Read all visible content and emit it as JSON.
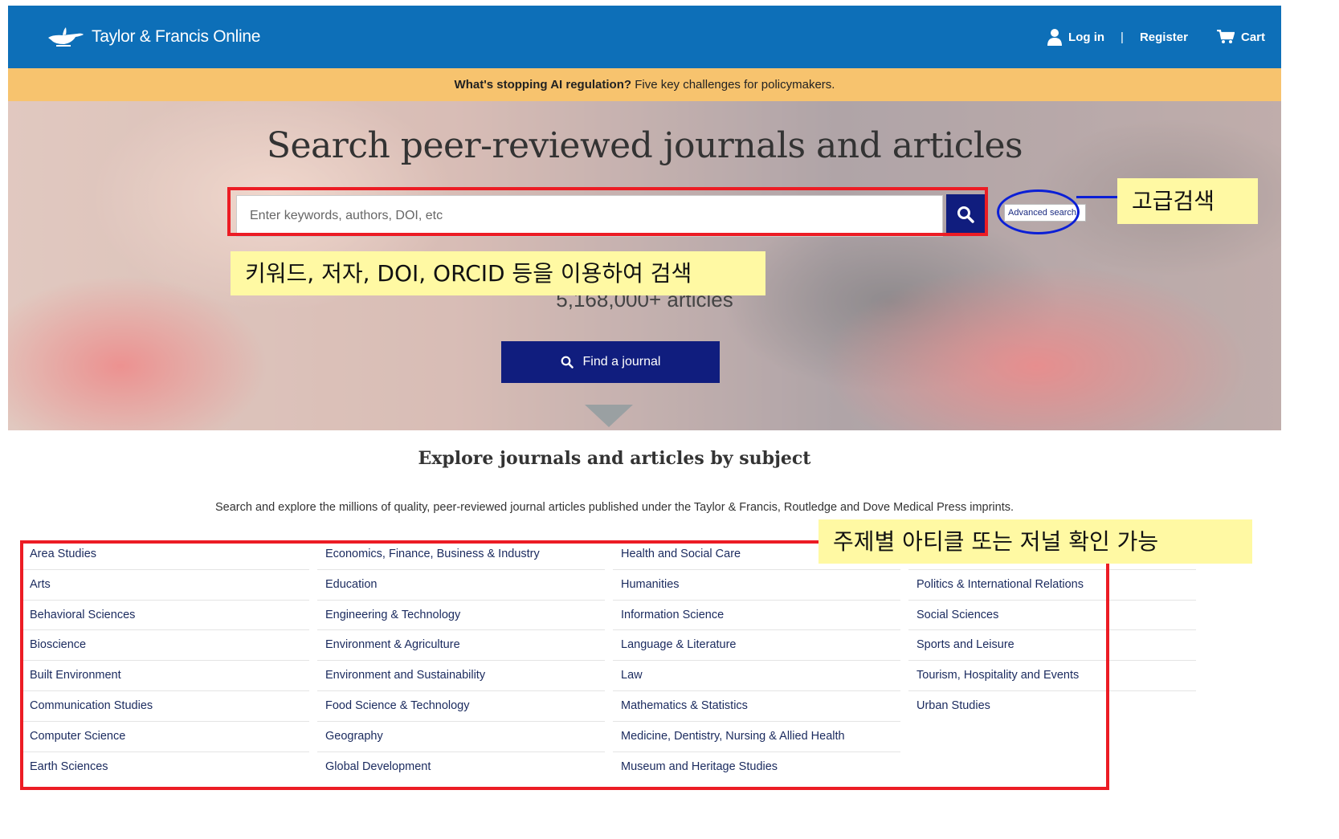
{
  "header": {
    "logo_text": "Taylor & Francis Online",
    "login_label": "Log in",
    "separator": "|",
    "register_label": "Register",
    "cart_label": "Cart",
    "background_color": "#0d6fb8"
  },
  "alert_banner": {
    "bold_text": "What's stopping AI regulation?",
    "text": " Five key challenges for policymakers."
  },
  "hero": {
    "title": "Search peer-reviewed journals and articles",
    "search_placeholder": "Enter keywords, authors, DOI, etc",
    "search_icon": "magnifier-icon",
    "advanced_search_label": "Advanced search",
    "article_count": "5,168,000+ articles",
    "find_journal_label": "Find a journal"
  },
  "annotations": {
    "search_note": "키워드, 저자, DOI, ORCID 등을 이용하여 검색",
    "advanced_note": "고급검색",
    "subject_note": "주제별 아티클 또는 저널 확인 가능",
    "highlight_color": "#ec1c24",
    "circle_color": "#0b1fd6"
  },
  "explore": {
    "title": "Explore journals and articles by subject",
    "description": "Search and explore the millions of quality, peer-reviewed journal articles published under the Taylor & Francis, Routledge and Dove Medical Press imprints."
  },
  "subjects": {
    "col1": [
      "Area Studies",
      "Arts",
      "Behavioral Sciences",
      "Bioscience",
      "Built Environment",
      "Communication Studies",
      "Computer Science",
      "Earth Sciences"
    ],
    "col2": [
      "Economics, Finance, Business & Industry",
      "Education",
      "Engineering & Technology",
      "Environment & Agriculture",
      "Environment and Sustainability",
      "Food Science & Technology",
      "Geography",
      "Global Development"
    ],
    "col3": [
      "Health and Social Care",
      "Humanities",
      "Information Science",
      "Language & Literature",
      "Law",
      "Mathematics & Statistics",
      "Medicine, Dentistry, Nursing & Allied Health",
      "Museum and Heritage Studies"
    ],
    "col4": [
      "",
      "Politics & International Relations",
      "Social Sciences",
      "Sports and Leisure",
      "Tourism, Hospitality and Events",
      "Urban Studies"
    ]
  }
}
